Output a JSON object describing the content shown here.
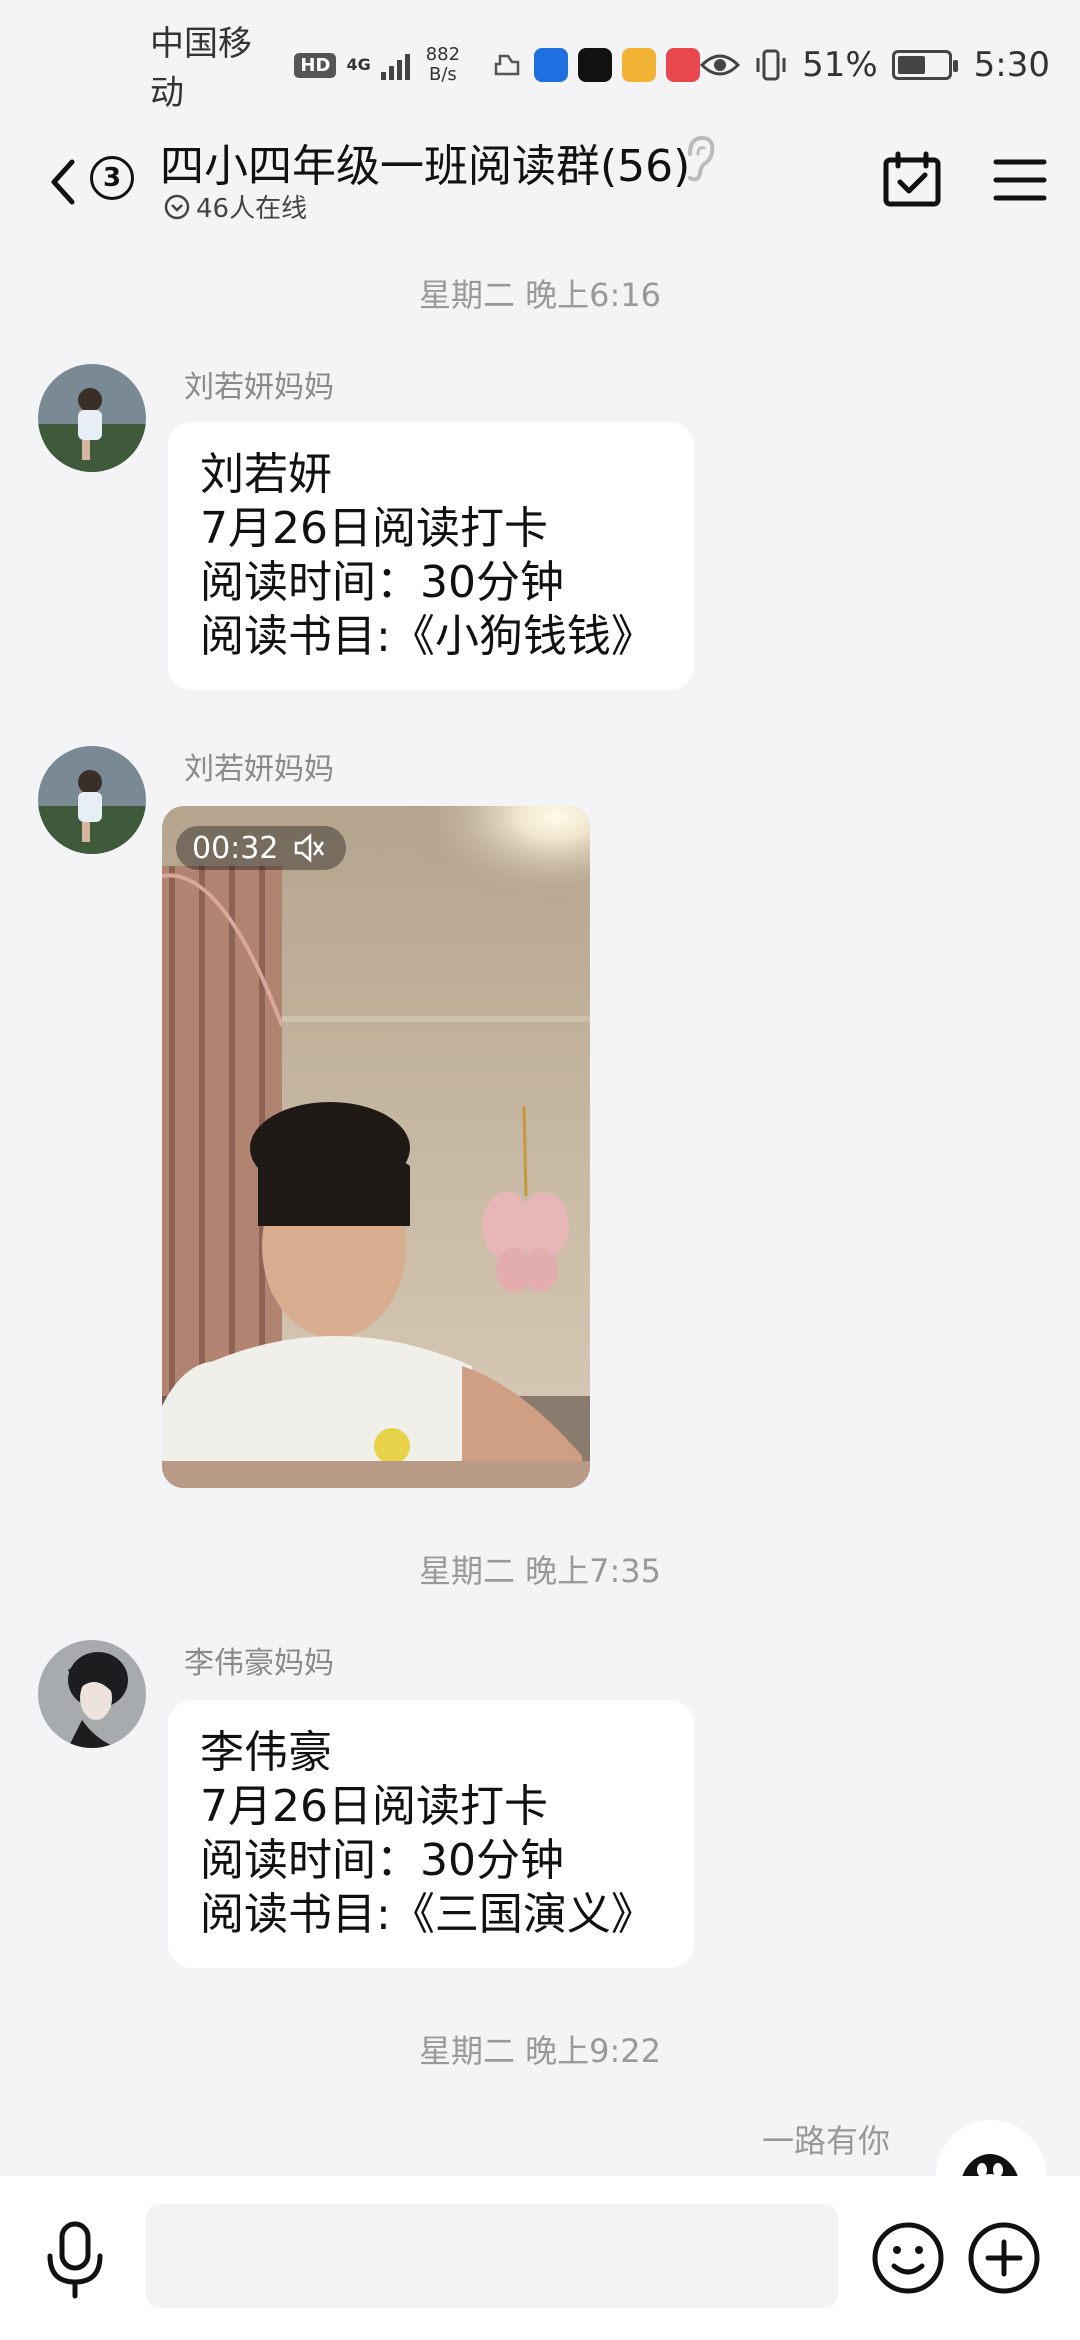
{
  "status_bar": {
    "carrier": "中国移动",
    "hd": "HD",
    "network": "4G",
    "speed_value": "882",
    "speed_unit": "B/s",
    "battery": "51%",
    "time": "5:30"
  },
  "header": {
    "unread_count": "3",
    "title": "四小四年级一班阅读群(56)",
    "online": "46人在线"
  },
  "messages": [
    {
      "timestamp": "星期二 晚上6:16"
    },
    {
      "sender": "刘若妍妈妈",
      "lines": [
        "刘若妍",
        "7月26日阅读打卡",
        "阅读时间：30分钟",
        "阅读书目:《小狗钱钱》"
      ]
    },
    {
      "sender": "刘若妍妈妈",
      "video_duration": "00:32"
    },
    {
      "timestamp": "星期二 晚上7:35"
    },
    {
      "sender": "李伟豪妈妈",
      "lines": [
        "李伟豪",
        "7月26日阅读打卡",
        "阅读时间：30分钟",
        "阅读书目:《三国演义》"
      ]
    },
    {
      "timestamp": "星期二 晚上9:22"
    },
    {
      "sender": "一路有你"
    }
  ],
  "input": {
    "value": "",
    "placeholder": ""
  },
  "colors": {
    "background": "#f4f4f6",
    "bubble": "#ffffff",
    "meta_text": "#999999"
  },
  "icons": [
    "back-icon",
    "ear-icon",
    "calendar-check-icon",
    "menu-icon",
    "mic-icon",
    "emoji-icon",
    "plus-icon",
    "mute-icon"
  ]
}
